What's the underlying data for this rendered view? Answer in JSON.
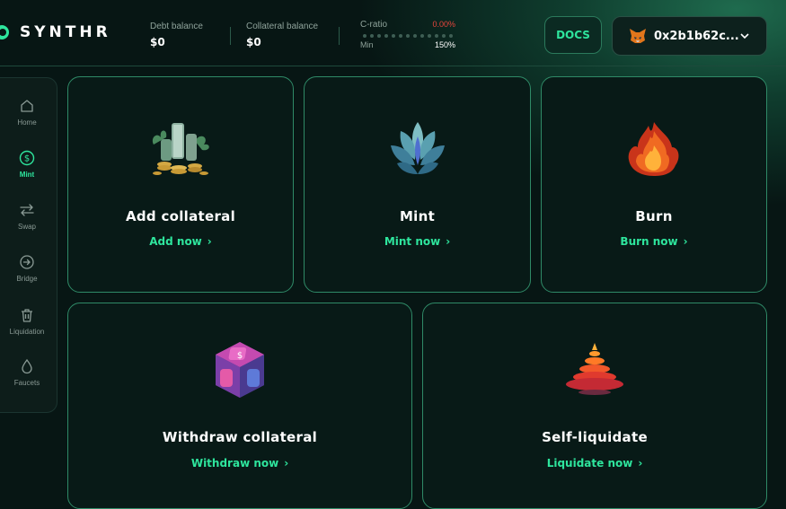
{
  "brand": {
    "name": "SYNTHR"
  },
  "header": {
    "debt": {
      "label": "Debt balance",
      "value": "$0"
    },
    "collateral": {
      "label": "Collateral balance",
      "value": "$0"
    },
    "cratio": {
      "label": "C-ratio",
      "current": "0.00%",
      "min_label": "Min",
      "min_value": "150%"
    },
    "docs_label": "DOCS",
    "wallet": {
      "address": "0x2b1b62c...",
      "icon": "metamask-fox-icon"
    }
  },
  "sidebar": {
    "items": [
      {
        "label": "Home",
        "icon": "home-icon"
      },
      {
        "label": "Mint",
        "icon": "dollar-icon",
        "active": true
      },
      {
        "label": "Swap",
        "icon": "swap-icon"
      },
      {
        "label": "Bridge",
        "icon": "bridge-icon"
      },
      {
        "label": "Liquidation",
        "icon": "trash-icon"
      },
      {
        "label": "Faucets",
        "icon": "drop-icon"
      }
    ]
  },
  "cards": [
    {
      "title": "Add collateral",
      "link": "Add now",
      "icon": "coins-stack-icon"
    },
    {
      "title": "Mint",
      "link": "Mint now",
      "icon": "crystal-lotus-icon"
    },
    {
      "title": "Burn",
      "link": "Burn now",
      "icon": "flame-icon"
    },
    {
      "title": "Withdraw collateral",
      "link": "Withdraw now",
      "icon": "vault-cube-icon"
    },
    {
      "title": "Self-liquidate",
      "link": "Liquidate now",
      "icon": "melting-cone-icon"
    }
  ],
  "colors": {
    "accent": "#2ee59d",
    "danger": "#e8453c",
    "background": "#071614",
    "card_border": "#2f8a67"
  }
}
